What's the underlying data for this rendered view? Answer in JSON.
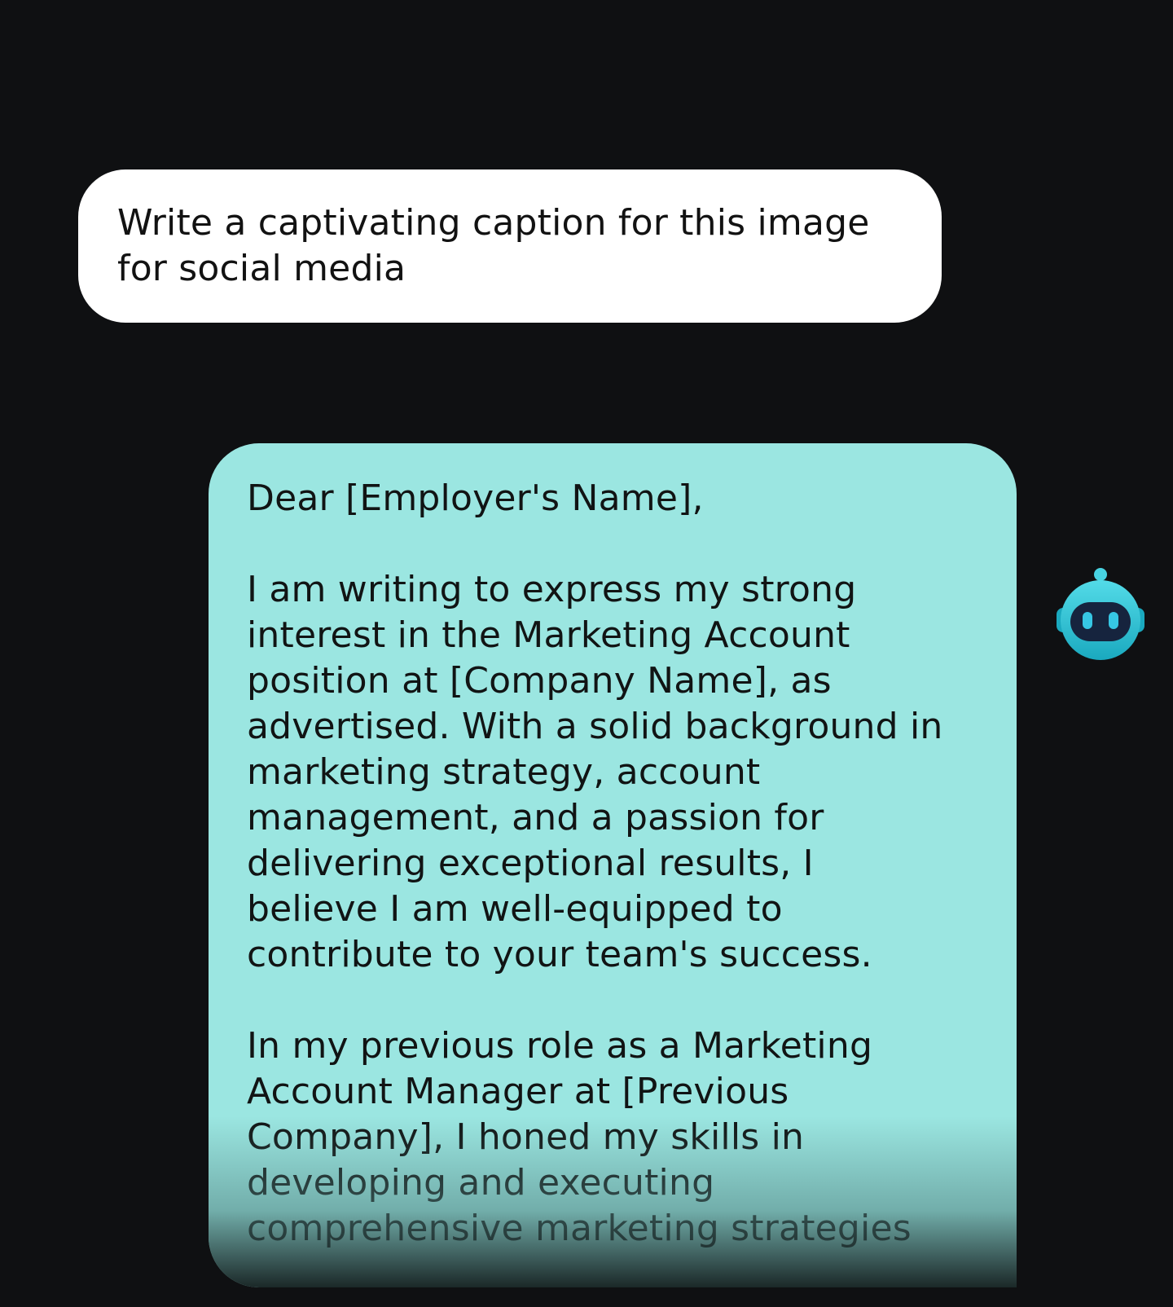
{
  "chat": {
    "user_message": {
      "text": "Write a captivating caption for this image\nfor social media"
    },
    "assistant_message": {
      "greeting": "Dear [Employer's Name],",
      "paragraph_1": "I am writing to express my strong\ninterest in the Marketing Account\nposition at [Company Name], as\nadvertised. With a solid background in\nmarketing strategy, account\nmanagement, and a passion for\ndelivering exceptional results, I\nbelieve I am well-equipped to\ncontribute to your team's success.",
      "paragraph_2": "In my previous role as a Marketing\nAccount Manager at [Previous\nCompany], I honed my skills in\ndeveloping and executing\ncomprehensive marketing strategies"
    },
    "assistant_avatar": {
      "icon": "robot-icon"
    }
  },
  "colors": {
    "background": "#0f1012",
    "user_bubble": "#ffffff",
    "assistant_bubble": "#9be6e1",
    "avatar": "#2fc3d6"
  }
}
